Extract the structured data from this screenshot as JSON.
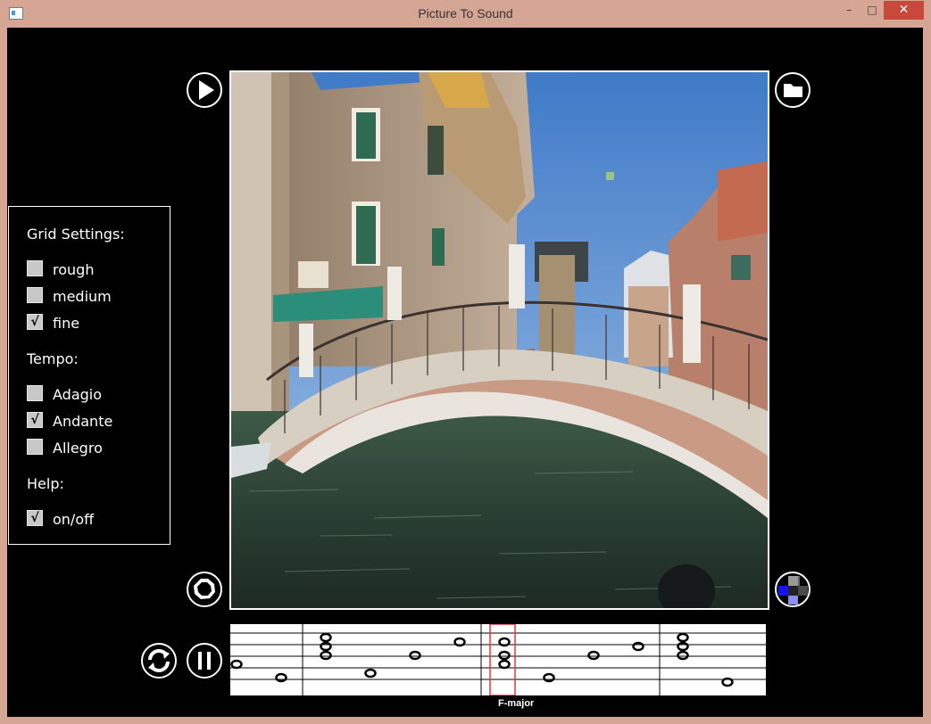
{
  "window": {
    "title": "Picture To Sound",
    "minimize_glyph": "–",
    "maximize_glyph": "□",
    "close_glyph": "✕"
  },
  "grid_settings": {
    "heading": "Grid Settings:",
    "options": [
      {
        "label": "rough",
        "checked": false
      },
      {
        "label": "medium",
        "checked": false
      },
      {
        "label": "fine",
        "checked": true
      }
    ]
  },
  "tempo": {
    "heading": "Tempo:",
    "options": [
      {
        "label": "Adagio",
        "checked": false
      },
      {
        "label": "Andante",
        "checked": true
      },
      {
        "label": "Allegro",
        "checked": false
      }
    ]
  },
  "help": {
    "heading": "Help:",
    "options": [
      {
        "label": "on/off",
        "checked": true
      }
    ]
  },
  "check_glyph": "√",
  "current_chord": "F-major",
  "icons": {
    "play": "play-icon",
    "open": "folder-icon",
    "settings": "octagon-icon",
    "color_picker": "color-grid-icon",
    "refresh": "refresh-icon",
    "pause": "pause-icon"
  },
  "colors": {
    "highlight": "#e0393b",
    "grid_blue": "#1515f0",
    "grid_lightblue": "#8a8ef5"
  }
}
